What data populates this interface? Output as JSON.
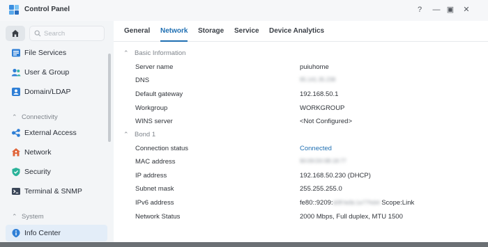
{
  "window": {
    "title": "Control Panel",
    "help_glyph": "?",
    "minimize_glyph": "—",
    "maximize_glyph": "▣",
    "close_glyph": "✕"
  },
  "sidebar": {
    "search_placeholder": "Search",
    "items": [
      {
        "label": "File Services",
        "icon": "folder-share-icon"
      },
      {
        "label": "User & Group",
        "icon": "users-icon"
      },
      {
        "label": "Domain/LDAP",
        "icon": "domain-icon"
      }
    ],
    "sections": [
      {
        "title": "Connectivity",
        "items": [
          {
            "label": "External Access",
            "icon": "external-access-icon"
          },
          {
            "label": "Network",
            "icon": "network-icon"
          },
          {
            "label": "Security",
            "icon": "shield-icon"
          },
          {
            "label": "Terminal & SNMP",
            "icon": "terminal-icon"
          }
        ]
      },
      {
        "title": "System",
        "items": [
          {
            "label": "Info Center",
            "icon": "info-icon",
            "active": true
          }
        ]
      }
    ]
  },
  "tabs": [
    {
      "label": "General"
    },
    {
      "label": "Network",
      "active": true
    },
    {
      "label": "Storage"
    },
    {
      "label": "Service"
    },
    {
      "label": "Device Analytics"
    }
  ],
  "basic_information": {
    "title": "Basic Information",
    "rows": [
      {
        "label": "Server name",
        "value": "puiuhome"
      },
      {
        "label": "DNS",
        "value": "95.141.35.238",
        "blurred": true
      },
      {
        "label": "Default gateway",
        "value": "192.168.50.1"
      },
      {
        "label": "Workgroup",
        "value": "WORKGROUP"
      },
      {
        "label": "WINS server",
        "value": "<Not Configured>"
      }
    ]
  },
  "bond_1": {
    "title": "Bond 1",
    "rows": [
      {
        "label": "Connection status",
        "value": "Connected",
        "status_color": "#1f6fb2"
      },
      {
        "label": "MAC address",
        "value": "90:09:D0:0B:18:77",
        "blurred": true
      },
      {
        "label": "IP address",
        "value": "192.168.50.230 (DHCP)"
      },
      {
        "label": "Subnet mask",
        "value": "255.255.255.0"
      },
      {
        "label": "IPv6 address",
        "value_prefix": "fe80::9209:",
        "value_hidden": "d0ff:fe0b:1e77%64",
        "value_suffix": " Scope:Link"
      },
      {
        "label": "Network Status",
        "value": "2000 Mbps, Full duplex, MTU 1500"
      }
    ]
  },
  "colors": {
    "accent": "#1f6fb2",
    "active_nav_bg": "#e3edf8"
  }
}
